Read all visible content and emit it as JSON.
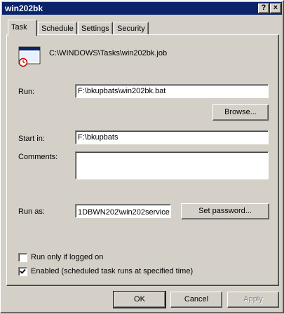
{
  "window": {
    "title": "win202bk",
    "help_glyph": "?",
    "close_glyph": "×"
  },
  "tabs": [
    {
      "label": "Task",
      "active": true
    },
    {
      "label": "Schedule",
      "active": false
    },
    {
      "label": "Settings",
      "active": false
    },
    {
      "label": "Security",
      "active": false
    }
  ],
  "task": {
    "icon": "scheduled-task-icon",
    "file_path": "C:\\WINDOWS\\Tasks\\win202bk.job",
    "run_label": "Run:",
    "run_value": "F:\\bkupbats\\win202bk.bat",
    "browse_label": "Browse...",
    "start_in_label": "Start in:",
    "start_in_value": "F:\\bkupbats",
    "comments_label": "Comments:",
    "comments_value": "",
    "run_as_label": "Run as:",
    "run_as_value": "1DBWN202\\win202service",
    "set_password_label": "Set password...",
    "run_only_logged_on_label": "Run only if logged on",
    "run_only_logged_on_checked": false,
    "enabled_label": "Enabled (scheduled task runs at specified time)",
    "enabled_checked": true
  },
  "footer": {
    "ok_label": "OK",
    "cancel_label": "Cancel",
    "apply_label": "Apply",
    "apply_enabled": false
  }
}
